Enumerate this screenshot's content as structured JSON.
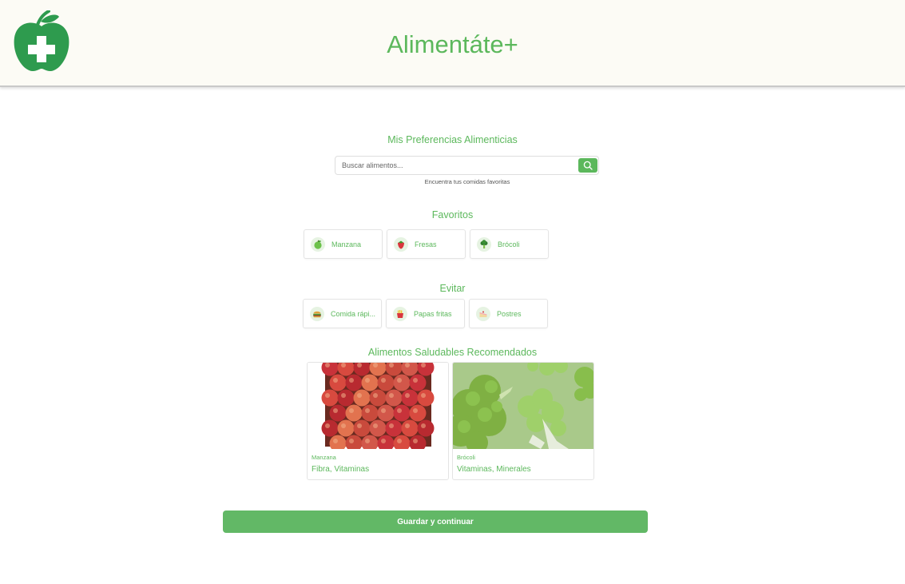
{
  "header": {
    "title": "Alimentáte+"
  },
  "preferences": {
    "title": "Mis Preferencias Alimenticias"
  },
  "search": {
    "placeholder": "Buscar alimentos...",
    "value": "",
    "helper": "Encuentra tus comidas favoritas",
    "icon": "search-icon"
  },
  "favorites": {
    "title": "Favoritos",
    "items": [
      {
        "label": "Manzana",
        "icon": "apple-icon"
      },
      {
        "label": "Fresas",
        "icon": "strawberry-icon"
      },
      {
        "label": "Brócoli",
        "icon": "broccoli-icon"
      }
    ]
  },
  "avoid": {
    "title": "Evitar",
    "items": [
      {
        "label": "Comida rápi...",
        "icon": "burger-icon"
      },
      {
        "label": "Papas fritas",
        "icon": "fries-icon"
      },
      {
        "label": "Postres",
        "icon": "cake-icon"
      }
    ]
  },
  "recommended": {
    "title": "Alimentos Saludables Recomendados",
    "items": [
      {
        "name": "Manzana",
        "nutrients": "Fibra, Vitaminas",
        "image": "apples-photo"
      },
      {
        "name": "Brócoli",
        "nutrients": "Vitaminas, Minerales",
        "image": "broccoli-photo"
      }
    ]
  },
  "actions": {
    "save_label": "Guardar y continuar"
  },
  "colors": {
    "accent": "#5cb85c",
    "header_bg": "#fcfbf5",
    "logo_green": "#2e9b4e"
  }
}
